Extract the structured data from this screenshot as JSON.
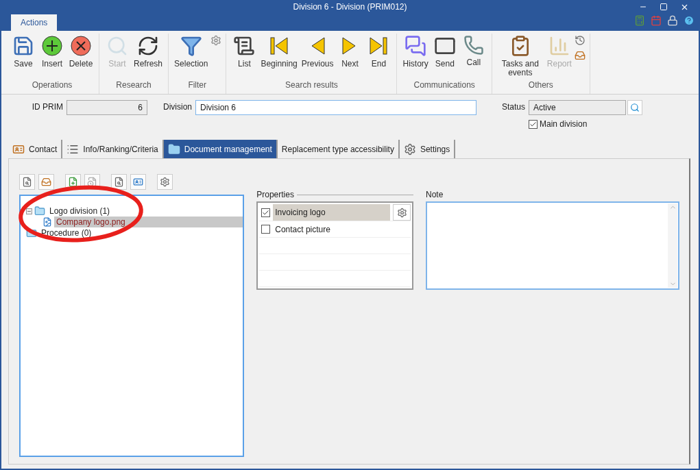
{
  "window": {
    "title": "Division 6 - Division (PRIM012)"
  },
  "ribbon": {
    "tabs": [
      {
        "label": "Actions",
        "selected": true
      }
    ],
    "groups": [
      {
        "label": "Operations",
        "buttons": [
          {
            "label": "Save",
            "disabled": false
          },
          {
            "label": "Insert",
            "disabled": false
          },
          {
            "label": "Delete",
            "disabled": false
          }
        ]
      },
      {
        "label": "Research",
        "buttons": [
          {
            "label": "Start",
            "disabled": true
          },
          {
            "label": "Refresh",
            "disabled": false
          }
        ]
      },
      {
        "label": "Filter",
        "buttons": [
          {
            "label": "Selection",
            "disabled": false
          }
        ]
      },
      {
        "label": "Search results",
        "buttons": [
          {
            "label": "List",
            "disabled": false
          },
          {
            "label": "Beginning",
            "disabled": false
          },
          {
            "label": "Previous",
            "disabled": false
          },
          {
            "label": "Next",
            "disabled": false
          },
          {
            "label": "End",
            "disabled": false
          }
        ]
      },
      {
        "label": "Communications",
        "buttons": [
          {
            "label": "History",
            "disabled": false
          },
          {
            "label": "Send",
            "disabled": false
          },
          {
            "label": "Call",
            "disabled": false
          }
        ]
      },
      {
        "label": "Others",
        "buttons": [
          {
            "label": "Tasks and events",
            "disabled": false
          },
          {
            "label": "Report",
            "disabled": true
          }
        ]
      }
    ]
  },
  "form": {
    "id_prim": {
      "label": "ID PRIM",
      "value": "6"
    },
    "division": {
      "label": "Division",
      "value": "Division 6"
    },
    "status": {
      "label": "Status",
      "value": "Active"
    },
    "main_division": {
      "label": "Main division",
      "checked": true
    }
  },
  "tabs": [
    {
      "label": "Contact",
      "selected": false
    },
    {
      "label": "Info/Ranking/Criteria",
      "selected": false
    },
    {
      "label": "Document management",
      "selected": true
    },
    {
      "label": "Replacement type accessibility",
      "selected": false
    },
    {
      "label": "Settings",
      "selected": false
    }
  ],
  "tree": [
    {
      "label": "Logo division (1)",
      "expanded": true,
      "selected": false,
      "children": [
        {
          "label": "Company logo.png",
          "selected": true
        }
      ]
    },
    {
      "label": "Procedure (0)",
      "selected": false
    }
  ],
  "properties": {
    "label": "Properties",
    "rows": [
      {
        "label": "Invoicing logo",
        "checked": true,
        "selected": true
      },
      {
        "label": "Contact picture",
        "checked": false,
        "selected": false
      }
    ]
  },
  "note": {
    "label": "Note"
  }
}
